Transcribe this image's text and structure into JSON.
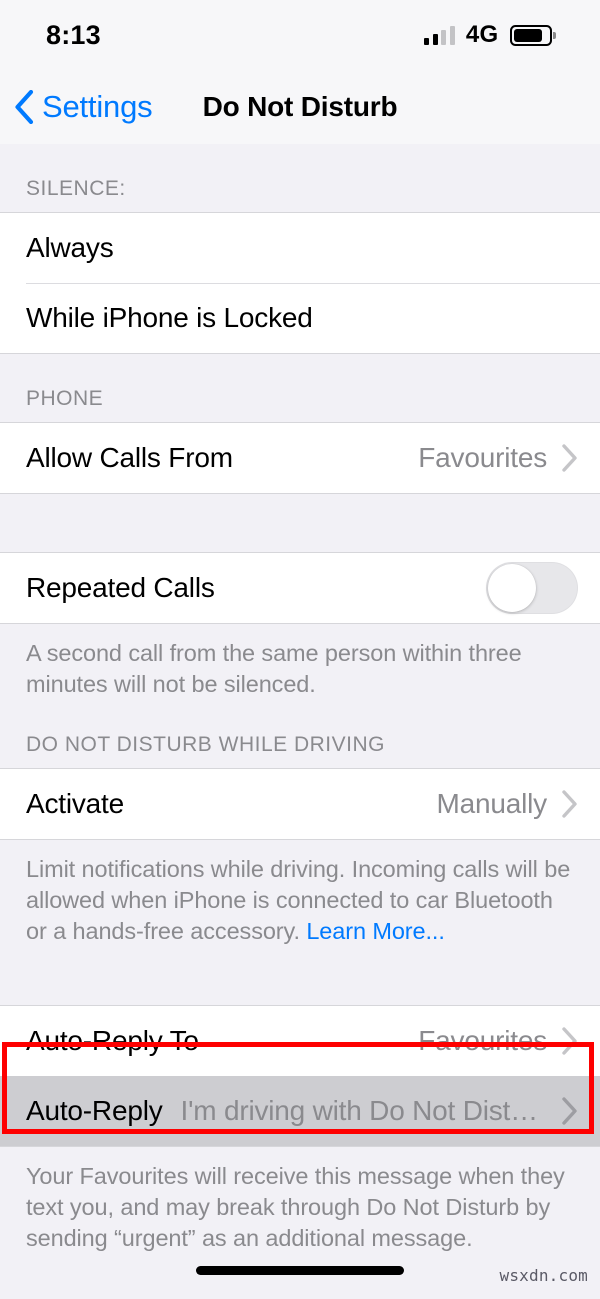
{
  "status_bar": {
    "time": "8:13",
    "network": "4G",
    "signal_icon": "cellular-bars-icon",
    "battery_icon": "battery-icon",
    "signal_bars_filled": 2,
    "signal_bars_total": 4,
    "battery_level_percent": 84
  },
  "nav": {
    "back_label": "Settings",
    "back_icon": "chevron-left-icon",
    "title": "Do Not Disturb"
  },
  "sections": {
    "silence": {
      "header": "SILENCE:",
      "rows": [
        {
          "title": "Always"
        },
        {
          "title": "While iPhone is Locked"
        }
      ]
    },
    "phone": {
      "header": "PHONE",
      "rows": [
        {
          "title": "Allow Calls From",
          "value": "Favourites",
          "accessory": "chevron-right-icon"
        }
      ]
    },
    "repeated": {
      "rows": [
        {
          "title": "Repeated Calls",
          "toggle": "off"
        }
      ],
      "footer": "A second call from the same person within three minutes will not be silenced."
    },
    "driving": {
      "header": "DO NOT DISTURB WHILE DRIVING",
      "rows": [
        {
          "title": "Activate",
          "value": "Manually",
          "accessory": "chevron-right-icon"
        }
      ],
      "footer_text": "Limit notifications while driving. Incoming calls will be allowed when iPhone is connected to car Bluetooth or a hands-free accessory. ",
      "footer_link": "Learn More..."
    },
    "autoreply": {
      "rows": [
        {
          "title": "Auto-Reply To",
          "value": "Favourites",
          "accessory": "chevron-right-icon"
        },
        {
          "title": "Auto-Reply",
          "value": "I'm driving with Do Not Distu...",
          "accessory": "chevron-right-icon",
          "state": "pressed",
          "highlighted": true
        }
      ],
      "footer": "Your Favourites will receive this message when they text you, and may break through Do Not Disturb by sending “urgent” as an additional message."
    }
  },
  "annotation": {
    "highlight_color": "#fe0000"
  },
  "watermark": "wsxdn.com",
  "colors": {
    "accent": "#007aff",
    "secondary_text": "#8a8a8e",
    "group_bg": "#ffffff",
    "page_bg": "#f2f1f6",
    "pressed_row": "#cdcdd1"
  }
}
